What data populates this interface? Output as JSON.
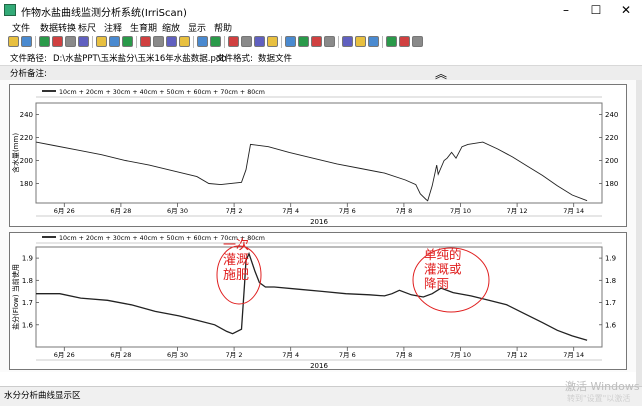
{
  "window": {
    "title": "作物水盐曲线监测分析系统(IrriScan)",
    "minimize": "–",
    "maximize": "☐",
    "close": "✕"
  },
  "menu": [
    "文件",
    "数据转换",
    "标尺",
    "注释",
    "生育期",
    "缩放",
    "显示",
    "帮助"
  ],
  "toolbar_icons": [
    "green-app-icon",
    "chart-dropdown-icon",
    "open-icon",
    "close-file-icon",
    "print-icon",
    "page-dropdown-icon",
    "marker-icon",
    "zoom-in-icon",
    "zoom-out-icon",
    "zoom-fit-icon",
    "zoom-select-icon",
    "binoculars-icon",
    "search-icon",
    "color-icon",
    "lock-icon",
    "export-icon",
    "save-icon",
    "save-all-icon",
    "doc-icon",
    "doc2-icon",
    "table-icon",
    "table2-icon",
    "axis-icon",
    "axis2-icon",
    "measure-icon",
    "ruler-icon",
    "help-icon",
    "info-icon",
    "about-icon"
  ],
  "path_info": {
    "path_label": "文件路径:",
    "path_value": "D:\\水盐PPT\\玉米盐分\\玉米16年水盐数据.pdb",
    "format_label": "文件格式:",
    "format_value": "数据文件"
  },
  "notes": {
    "label": "分析备注:",
    "collapse_icon": "︽"
  },
  "status": {
    "label": "水分分析曲线显示区",
    "watermark_line1": "激活 Windows",
    "watermark_line2": "转到\"设置\"以激活"
  },
  "colors": {
    "annotation_red": "#e02020",
    "line": "#222222"
  },
  "chart_data": [
    {
      "type": "line",
      "legend": "10cm + 20cm + 30cm + 40cm + 50cm + 60cm + 70cm + 80cm",
      "ylabel": "含水量(mm)",
      "xlabel": "2016",
      "xticks": [
        "6月 26",
        "6月 28",
        "6月 30",
        "7月 2",
        "7月 4",
        "7月 6",
        "7月 8",
        "7月 10",
        "7月 12",
        "7月 14"
      ],
      "yticks": [
        180,
        200,
        220,
        240
      ],
      "xlim": [
        0,
        19
      ],
      "ylim": [
        163,
        250
      ],
      "x": [
        0,
        0.6,
        1.4,
        2.2,
        3,
        3.8,
        4.6,
        5.4,
        5.8,
        6.2,
        6.9,
        7.05,
        7.2,
        7.8,
        8.5,
        9.3,
        10.1,
        10.9,
        11.7,
        12.4,
        12.75,
        12.9,
        13.1,
        13.15,
        13.3,
        13.45,
        13.5,
        13.7,
        13.8,
        13.95,
        14.1,
        14.3,
        14.5,
        15,
        15.5,
        16,
        16.5,
        17,
        17.5,
        18,
        18.5
      ],
      "y": [
        216,
        213,
        209,
        205,
        200,
        196,
        191,
        186,
        180,
        179,
        181,
        192,
        214,
        212,
        207,
        202,
        197,
        193,
        189,
        183,
        179,
        171,
        166,
        165,
        178,
        196,
        188,
        200,
        202,
        207,
        202,
        212,
        214,
        216,
        210,
        203,
        195,
        187,
        178,
        170,
        165
      ]
    },
    {
      "type": "line",
      "legend": "10cm + 20cm + 30cm + 40cm + 50cm + 60cm + 70cm + 80cm",
      "ylabel": "盐分(Flow) 当前使用",
      "xlabel": "2016",
      "xticks": [
        "6月 26",
        "6月 28",
        "6月 30",
        "7月 2",
        "7月 4",
        "7月 6",
        "7月 8",
        "7月 10",
        "7月 12",
        "7月 14"
      ],
      "yticks": [
        1.6,
        1.7,
        1.8,
        1.9
      ],
      "xlim": [
        0,
        19
      ],
      "ylim": [
        1.5,
        1.95
      ],
      "x": [
        0,
        0.8,
        1.5,
        2.4,
        3.2,
        4,
        4.8,
        5.4,
        6,
        6.4,
        6.6,
        6.9,
        7,
        7.05,
        7.15,
        7.35,
        7.5,
        7.7,
        8,
        8.8,
        9.6,
        10.4,
        11.2,
        11.7,
        11.95,
        12.2,
        12.6,
        13,
        13.3,
        13.6,
        14,
        14.6,
        15.2,
        15.8,
        16.4,
        17,
        17.5,
        18,
        18.5
      ],
      "y": [
        1.74,
        1.74,
        1.72,
        1.71,
        1.69,
        1.66,
        1.64,
        1.62,
        1.6,
        1.57,
        1.56,
        1.58,
        1.78,
        1.89,
        1.92,
        1.84,
        1.79,
        1.77,
        1.77,
        1.76,
        1.75,
        1.74,
        1.735,
        1.73,
        1.74,
        1.755,
        1.735,
        1.725,
        1.74,
        1.765,
        1.745,
        1.73,
        1.71,
        1.69,
        1.65,
        1.61,
        1.575,
        1.55,
        1.53
      ]
    }
  ],
  "annotations": [
    {
      "text_lines": [
        "一次",
        "灌溉",
        "施肥"
      ]
    },
    {
      "text_lines": [
        "单纯的",
        "灌溉或",
        "降雨"
      ]
    }
  ]
}
